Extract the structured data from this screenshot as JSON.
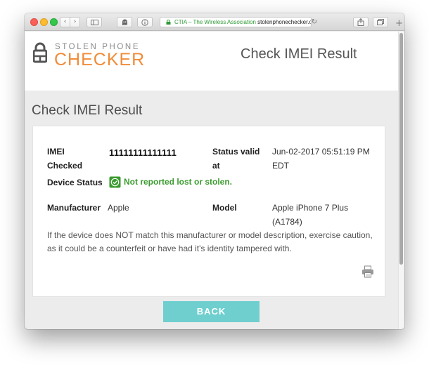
{
  "browser": {
    "address": {
      "site_label": "CTIA – The Wireless Association",
      "url_text": "stolenphonechecker.org"
    },
    "icons": {
      "back": "chevron-left",
      "forward": "chevron-right",
      "sidebar": "sidebar",
      "ghostery": "ghost-extension",
      "privacy": "info-circle",
      "reload": "reload",
      "share": "share",
      "tabs": "tab-overview",
      "new_tab": "plus"
    }
  },
  "header": {
    "logo_top": "STOLEN PHONE",
    "logo_main": "CHECKER",
    "title": "Check IMEI Result"
  },
  "page": {
    "title": "Check IMEI Result"
  },
  "result": {
    "imei_label": "IMEI Checked",
    "imei_value": "11111111111111",
    "status_valid_label": "Status valid at",
    "status_valid_value": "Jun-02-2017 05:51:19 PM EDT",
    "device_status_label": "Device Status",
    "device_status_value": "Not reported lost or stolen.",
    "manufacturer_label": "Manufacturer",
    "manufacturer_value": "Apple",
    "model_label": "Model",
    "model_value": "Apple iPhone 7 Plus (A1784)",
    "note": "If the device does NOT match this manufacturer or model description, exercise caution, as it could be a counterfeit or have had it's identity tampered with."
  },
  "actions": {
    "back_label": "BACK"
  },
  "colors": {
    "accent_orange": "#f08c3a",
    "status_green": "#3a9b2e",
    "button_teal": "#6fcfcf",
    "page_background": "#ececec"
  }
}
